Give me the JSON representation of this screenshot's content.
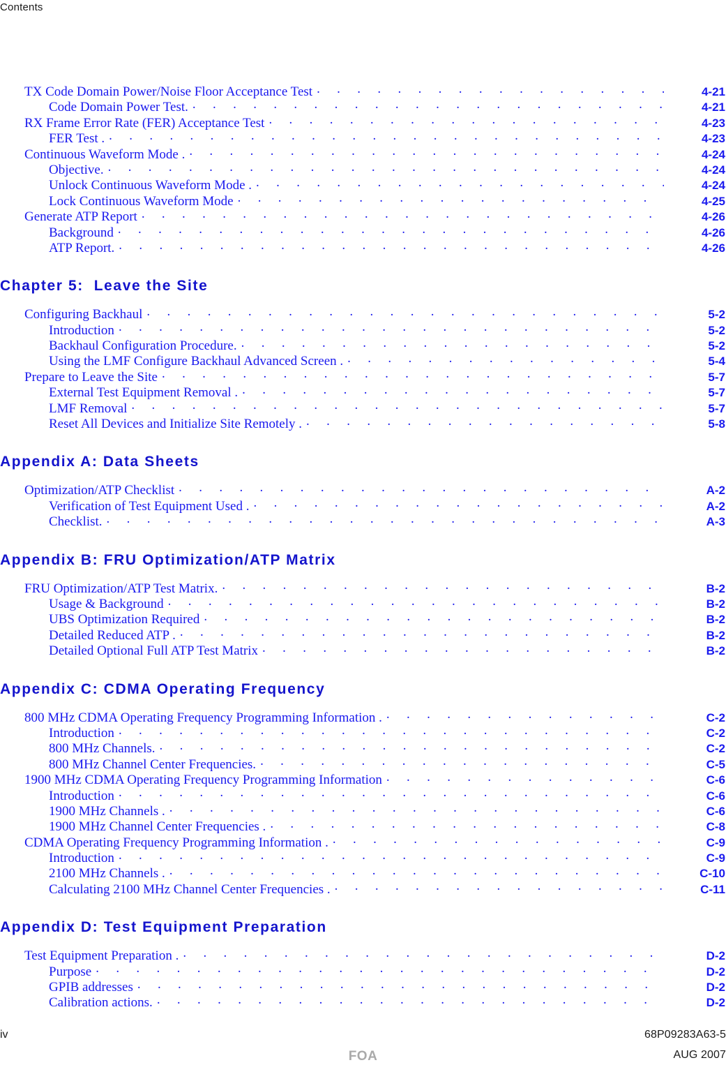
{
  "header": {
    "running_title": "Contents"
  },
  "colors": {
    "link_blue": "#1a1aee",
    "heading_blue": "#1414cc",
    "footer_text": "#1a1a1a",
    "watermark_gray": "#aaaaaa"
  },
  "toc": {
    "blocks": [
      {
        "heading": null,
        "entries": [
          {
            "level": 1,
            "label": "TX Code Domain Power/Noise Floor Acceptance Test",
            "page": "4-21"
          },
          {
            "level": 2,
            "label": "Code Domain Power Test.",
            "page": "4-21"
          },
          {
            "level": 1,
            "label": "RX Frame Error Rate (FER) Acceptance Test",
            "page": "4-23"
          },
          {
            "level": 2,
            "label": "FER Test .",
            "page": "4-23"
          },
          {
            "level": 1,
            "label": "Continuous Waveform Mode .",
            "page": "4-24"
          },
          {
            "level": 2,
            "label": "Objective.",
            "page": "4-24"
          },
          {
            "level": 2,
            "label": "Unlock Continuous Waveform Mode .",
            "page": "4-24"
          },
          {
            "level": 2,
            "label": "Lock Continuous Waveform Mode",
            "page": "4-25"
          },
          {
            "level": 1,
            "label": "Generate ATP Report",
            "page": "4-26"
          },
          {
            "level": 2,
            "label": "Background",
            "page": "4-26"
          },
          {
            "level": 2,
            "label": "ATP Report.",
            "page": "4-26"
          }
        ]
      },
      {
        "heading": "Chapter 5:  Leave the Site",
        "entries": [
          {
            "level": 1,
            "label": "Configuring Backhaul",
            "page": "5-2"
          },
          {
            "level": 2,
            "label": "Introduction",
            "page": "5-2"
          },
          {
            "level": 2,
            "label": "Backhaul Configuration Procedure.",
            "page": "5-2"
          },
          {
            "level": 2,
            "label": "Using the LMF Configure Backhaul Advanced Screen .",
            "page": "5-4"
          },
          {
            "level": 1,
            "label": "Prepare to Leave the Site",
            "page": "5-7"
          },
          {
            "level": 2,
            "label": "External Test Equipment Removal .",
            "page": "5-7"
          },
          {
            "level": 2,
            "label": "LMF Removal",
            "page": "5-7"
          },
          {
            "level": 2,
            "label": "Reset All Devices and Initialize Site Remotely .",
            "page": "5-8"
          }
        ]
      },
      {
        "heading": "Appendix A: Data Sheets",
        "entries": [
          {
            "level": 1,
            "label": "Optimization/ATP Checklist",
            "page": "A-2"
          },
          {
            "level": 2,
            "label": "Verification of Test Equipment Used .",
            "page": "A-2"
          },
          {
            "level": 2,
            "label": "Checklist.",
            "page": "A-3"
          }
        ]
      },
      {
        "heading": "Appendix B: FRU Optimization/ATP Matrix",
        "entries": [
          {
            "level": 1,
            "label": "FRU Optimization/ATP Test Matrix.",
            "page": "B-2"
          },
          {
            "level": 2,
            "label": "Usage & Background",
            "page": "B-2"
          },
          {
            "level": 2,
            "label": "UBS Optimization Required",
            "page": "B-2"
          },
          {
            "level": 2,
            "label": "Detailed Reduced ATP .",
            "page": "B-2"
          },
          {
            "level": 2,
            "label": "Detailed Optional Full ATP Test Matrix",
            "page": "B-2"
          }
        ]
      },
      {
        "heading": "Appendix C: CDMA Operating Frequency",
        "entries": [
          {
            "level": 1,
            "label": "800 MHz CDMA Operating Frequency Programming Information .",
            "page": "C-2"
          },
          {
            "level": 2,
            "label": "Introduction",
            "page": "C-2"
          },
          {
            "level": 2,
            "label": "800 MHz Channels.",
            "page": "C-2"
          },
          {
            "level": 2,
            "label": "800 MHz Channel Center Frequencies.",
            "page": "C-5"
          },
          {
            "level": 1,
            "label": "1900 MHz CDMA Operating Frequency Programming Information",
            "page": "C-6"
          },
          {
            "level": 2,
            "label": "Introduction",
            "page": "C-6"
          },
          {
            "level": 2,
            "label": "1900 MHz Channels .",
            "page": "C-6"
          },
          {
            "level": 2,
            "label": "1900 MHz Channel Center Frequencies .",
            "page": "C-8"
          },
          {
            "level": 1,
            "label": "CDMA Operating Frequency Programming Information .",
            "page": "C-9"
          },
          {
            "level": 2,
            "label": "Introduction",
            "page": "C-9"
          },
          {
            "level": 2,
            "label": "2100 MHz Channels .",
            "page": "C-10"
          },
          {
            "level": 2,
            "label": "Calculating 2100 MHz Channel Center Frequencies .",
            "page": "C-11"
          }
        ]
      },
      {
        "heading": "Appendix D: Test Equipment Preparation",
        "entries": [
          {
            "level": 1,
            "label": "Test Equipment Preparation .",
            "page": "D-2"
          },
          {
            "level": 2,
            "label": "Purpose",
            "page": "D-2"
          },
          {
            "level": 2,
            "label": "GPIB addresses",
            "page": "D-2"
          },
          {
            "level": 2,
            "label": "Calibration actions.",
            "page": "D-2"
          }
        ]
      }
    ]
  },
  "footer": {
    "page_number": "iv",
    "document_number": "68P09283A63-5",
    "watermark": "FOA",
    "date": "AUG 2007"
  }
}
